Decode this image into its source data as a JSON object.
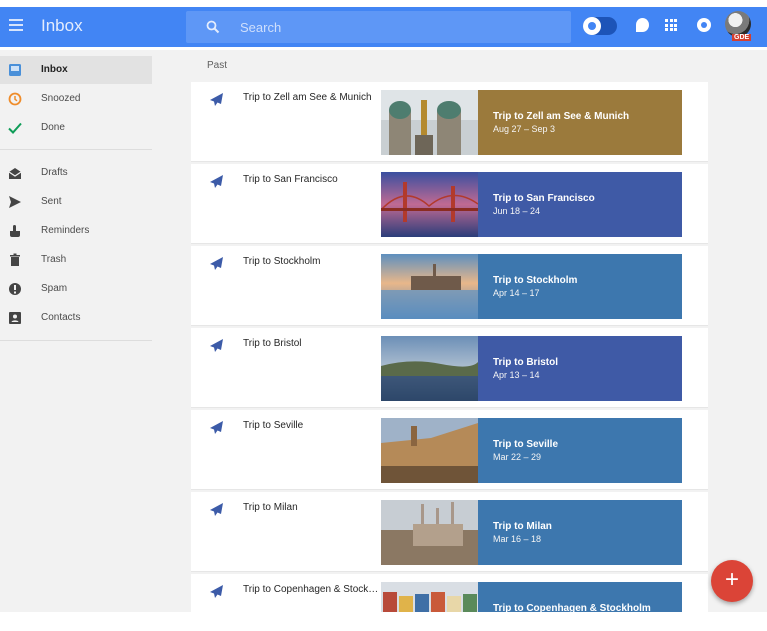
{
  "app": {
    "title": "Inbox"
  },
  "search": {
    "placeholder": "Search"
  },
  "header_icons": [
    "menu-icon",
    "search-icon",
    "pin-toggle",
    "hangouts-icon",
    "apps-grid-icon",
    "notifications-icon",
    "avatar"
  ],
  "avatar_tag": "GDE",
  "sidebar": {
    "items": [
      {
        "label": "Inbox",
        "icon": "inbox-icon",
        "active": true
      },
      {
        "label": "Snoozed",
        "icon": "clock-icon"
      },
      {
        "label": "Done",
        "icon": "check-icon"
      },
      {
        "label": "Drafts",
        "icon": "drafts-icon"
      },
      {
        "label": "Sent",
        "icon": "send-icon"
      },
      {
        "label": "Reminders",
        "icon": "reminder-icon"
      },
      {
        "label": "Trash",
        "icon": "trash-icon"
      },
      {
        "label": "Spam",
        "icon": "spam-icon"
      },
      {
        "label": "Contacts",
        "icon": "contacts-icon"
      }
    ]
  },
  "main": {
    "section": "Past",
    "trips": [
      {
        "title": "Trip to Zell am See & Munich",
        "panel_title": "Trip to Zell am See & Munich",
        "dates": "Aug 27 – Sep 3",
        "color": "#9b7a3c"
      },
      {
        "title": "Trip to San Francisco",
        "panel_title": "Trip to San Francisco",
        "dates": "Jun 18 – 24",
        "color": "#3f5aa6"
      },
      {
        "title": "Trip to Stockholm",
        "panel_title": "Trip to Stockholm",
        "dates": "Apr 14 – 17",
        "color": "#3d77ae"
      },
      {
        "title": "Trip to Bristol",
        "panel_title": "Trip to Bristol",
        "dates": "Apr 13 – 14",
        "color": "#3f5aa6"
      },
      {
        "title": "Trip to Seville",
        "panel_title": "Trip to Seville",
        "dates": "Mar 22 – 29",
        "color": "#3d77ae"
      },
      {
        "title": "Trip to Milan",
        "panel_title": "Trip to Milan",
        "dates": "Mar 16 – 18",
        "color": "#3d77ae"
      },
      {
        "title": "Trip to Copenhagen & Stockh...",
        "panel_title": "Trip to Copenhagen & Stockholm",
        "dates": "",
        "color": "#3d77ae"
      }
    ]
  },
  "fab": {
    "label": "+"
  },
  "colors": {
    "appbar": "#4285f4",
    "sidebar_bg": "#f2f2f2",
    "fab": "#db4437"
  }
}
